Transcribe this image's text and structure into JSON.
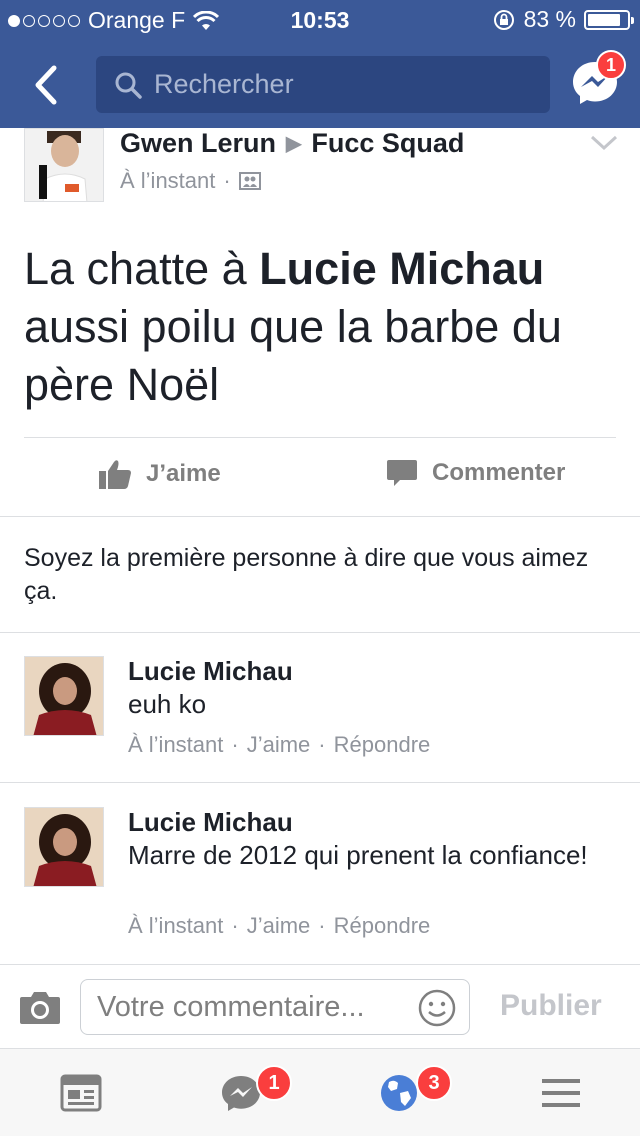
{
  "status_bar": {
    "carrier": "Orange F",
    "time": "10:53",
    "battery_text": "83 %",
    "battery_level": 0.83,
    "signal_filled": 1,
    "signal_total": 5
  },
  "nav": {
    "search_placeholder": "Rechercher",
    "messenger_badge": "1"
  },
  "post": {
    "author": "Gwen Lerun",
    "group": "Fucc Squad",
    "time": "À l’instant",
    "text_part1": "La chatte à ",
    "text_tagged": "Lucie Michau",
    "text_part2": " aussi poilu que la barbe du père Noël",
    "like_label": "J’aime",
    "comment_label": "Commenter",
    "first_like_text": "Soyez la première personne à dire que vous aimez ça."
  },
  "comments": [
    {
      "author": "Lucie Michau",
      "text": "euh ko",
      "time": "À l’instant",
      "like": "J’aime",
      "reply": "Répondre"
    },
    {
      "author": "Lucie Michau",
      "text": "Marre de 2012 qui prenent la confiance!",
      "time": "À l’instant",
      "like": "J’aime",
      "reply": "Répondre"
    }
  ],
  "composer": {
    "placeholder": "Votre commentaire...",
    "publish_label": "Publier"
  },
  "tabbar": {
    "messages_badge": "1",
    "notifications_badge": "3"
  },
  "colors": {
    "brand": "#3b5998",
    "badge": "#fa3e3e",
    "muted_text": "#90949c"
  }
}
